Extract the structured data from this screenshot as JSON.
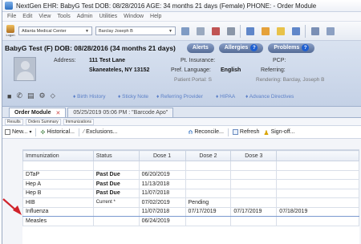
{
  "titlebar": {
    "title": "NextGen EHR: BabyG Test  DOB: 08/28/2016  AGE: 34 months 21 days  (Female)  PHONE:  - Order Module"
  },
  "menu": {
    "items": [
      "File",
      "Edit",
      "View",
      "Tools",
      "Admin",
      "Utilities",
      "Window",
      "Help"
    ]
  },
  "toolbar": {
    "logon_label": "Logon",
    "location": "Atlanta Medical Center",
    "provider": "Barclay Joseph B",
    "buttons": [
      {
        "label": "New",
        "color": "#7f9bc4"
      },
      {
        "label": "Open",
        "color": "#9aa9bf"
      },
      {
        "label": "Delete",
        "color": "#c05454"
      },
      {
        "label": "Print",
        "color": "#8a96a8"
      },
      {
        "label": "Chart",
        "color": "#5f86c9"
      },
      {
        "label": "Pmt",
        "color": "#e5a13a"
      },
      {
        "label": "Refresh",
        "color": "#e8c24a"
      },
      {
        "label": "Tasks",
        "color": "#5f86c9"
      },
      {
        "label": "Templates",
        "color": "#7a8fb5"
      },
      {
        "label": "Images",
        "color": "#8ca0c2"
      }
    ]
  },
  "banner": {
    "patient_header": "BabyG Test  (F)  DOB: 08/28/2016 (34 months 21 days)",
    "alerts": "Alerts",
    "allergies": "Allergies",
    "problems": "Problems",
    "address_label": "Address:",
    "address_line1": "111 Test Lane",
    "address_line2": "Skaneateles, NY 13152",
    "pt_insurance_label": "Pt. Insurance:",
    "pcp_label": "PCP:",
    "pref_language_label": "Pref. Language:",
    "pref_language_value": "English",
    "referring_label": "Referring:",
    "blurred_1": "Patient Portal:  S",
    "blurred_2": "Rendering:    Barclay, Joseph B",
    "links": [
      "Birth History",
      "Sticky Note",
      "Referring Provider",
      "HIPAA",
      "Advance Directives"
    ]
  },
  "tabs": {
    "order_module": "Order Module",
    "encounter": "05/25/2019 05:06 PM : \"Barcode Apo\""
  },
  "subtabs": [
    "Results",
    "Orders Summary",
    "Immunizations"
  ],
  "actions": {
    "new": "New...",
    "historical": "Historical...",
    "exclusions": "Exclusions...",
    "reconcile": "Reconcile...",
    "refresh": "Refresh",
    "signoff": "Sign-off..."
  },
  "grid": {
    "columns": [
      "Immunization",
      "Status",
      "Dose 1",
      "Dose 2",
      "Dose 3",
      ""
    ],
    "rows": [
      {
        "name": "",
        "status": "",
        "d1": "",
        "d2": "",
        "d3": "",
        "d4": ""
      },
      {
        "name": "DTaP",
        "status": "Past Due",
        "d1": "06/20/2019",
        "d2": "",
        "d3": "",
        "d4": ""
      },
      {
        "name": "Hep A",
        "status": "Past Due",
        "d1": "11/13/2018",
        "d2": "",
        "d3": "",
        "d4": ""
      },
      {
        "name": "Hep B",
        "status": "Past Due",
        "d1": "11/07/2018",
        "d2": "",
        "d3": "",
        "d4": ""
      },
      {
        "name": "HIB",
        "status": "Current *",
        "d1": "07/02/2019",
        "d2": "Pending",
        "d3": "",
        "d4": ""
      },
      {
        "name": "Influenza",
        "status": "",
        "d1": "11/07/2018",
        "d2": "07/17/2019",
        "d3": "07/17/2019",
        "d4": "07/18/2019"
      },
      {
        "name": "Measles",
        "status": "",
        "d1": "06/24/2019",
        "d2": "",
        "d3": "",
        "d4": ""
      }
    ]
  },
  "colors": {
    "past_due": "#d4232a",
    "annotation_arrow": "#d0232b",
    "link": "#5a7fc7"
  }
}
